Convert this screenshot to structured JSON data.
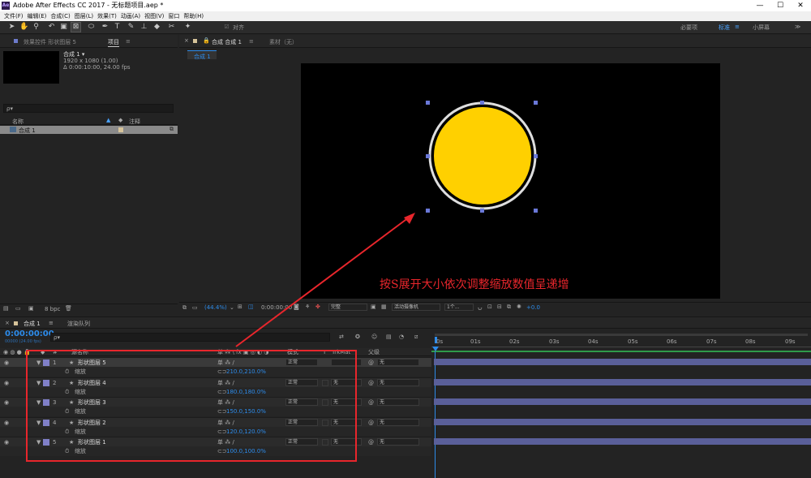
{
  "app": {
    "title": "Adobe After Effects CC 2017 - 无标题项目.aep *",
    "logo": "Ae",
    "min": "—",
    "max": "☐",
    "close": "✕"
  },
  "menu": [
    "文件(F)",
    "编辑(E)",
    "合成(C)",
    "图层(L)",
    "效果(T)",
    "动画(A)",
    "视图(V)",
    "窗口",
    "帮助(H)"
  ],
  "toolbar": {
    "align_label": "对齐",
    "workspaces": [
      "必要项",
      "标准",
      "小屏幕"
    ],
    "ws_more": "≫",
    "tools": [
      "selection-tool-icon",
      "hand-tool-icon",
      "zoom-tool-icon",
      "rotate-tool-icon",
      "camera-tool-icon",
      "anchor-tool-icon",
      "shape-tool-icon",
      "pen-tool-icon",
      "type-tool-icon",
      "brush-tool-icon",
      "clone-tool-icon",
      "eraser-tool-icon",
      "roto-tool-icon",
      "puppet-tool-icon"
    ]
  },
  "project_panel": {
    "tab_effects": "效果控件 形状图层 5",
    "tab_project": "项目",
    "tab_menu": "≡",
    "comp_name": "合成 1 ▾",
    "comp_info1": "1920 x 1080 (1.00)",
    "comp_info2": "Δ 0:00:10:00, 24.00 fps",
    "search_placeholder": "ρ▾",
    "col_name": "名称",
    "col_comment": "注释",
    "item": "合成 1",
    "footer_bpc": "8 bpc"
  },
  "comp_panel": {
    "tab_label": "合成 合成 1",
    "tab_menu": "≡",
    "footage_label": "素材（无）",
    "breadcrumb": "合成 1",
    "annotation": "按S展开大小依次调整缩放数值呈递增",
    "footer": {
      "zoom": "(44.4%)",
      "time": "0:00:00:00",
      "resolution": "完整",
      "camera": "活动摄像机",
      "views": "1个...",
      "exposure": "+0.0"
    }
  },
  "colors": {
    "circle_fill": "#FFD000",
    "circle_stroke": "#E6E6E6",
    "accent": "#2D8CEB",
    "annotation": "#E8262C"
  },
  "timeline": {
    "tab_comp": "合成 1",
    "tab_menu": "≡",
    "tab_render": "渲染队列",
    "timecode": "0:00:00:00",
    "timecode_sub": "00000 (24.00 fps)",
    "search_placeholder": "ρ▾",
    "headers": {
      "num": "#",
      "source": "源名称",
      "switches": "单 ⁂ \\ fx ▣ ◎ ◐ ◑",
      "mode": "模式",
      "t": "T",
      "trkmat": "TrkMat",
      "parent": "父级"
    },
    "ruler": [
      "0s",
      "01s",
      "02s",
      "03s",
      "04s",
      "05s",
      "06s",
      "07s",
      "08s",
      "09s"
    ],
    "layers": [
      {
        "num": "1",
        "name": "形状图层 5",
        "mode": "正常",
        "trk": "",
        "parent": "无",
        "prop": "缩放",
        "value": "210.0,210.0%"
      },
      {
        "num": "2",
        "name": "形状图层 4",
        "mode": "正常",
        "trk": "无",
        "parent": "无",
        "prop": "缩放",
        "value": "180.0,180.0%"
      },
      {
        "num": "3",
        "name": "形状图层 3",
        "mode": "正常",
        "trk": "无",
        "parent": "无",
        "prop": "缩放",
        "value": "150.0,150.0%"
      },
      {
        "num": "4",
        "name": "形状图层 2",
        "mode": "正常",
        "trk": "无",
        "parent": "无",
        "prop": "缩放",
        "value": "120.0,120.0%"
      },
      {
        "num": "5",
        "name": "形状图层 1",
        "mode": "正常",
        "trk": "无",
        "parent": "无",
        "prop": "缩放",
        "value": "100.0,100.0%"
      }
    ]
  }
}
